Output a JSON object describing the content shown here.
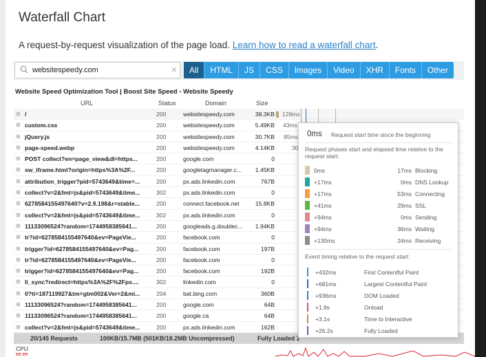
{
  "header": {
    "title": "Waterfall Chart",
    "subtitle": "A request-by-request visualization of the page load.",
    "link_text": "Learn how to read a waterfall chart",
    "link_suffix": "."
  },
  "search": {
    "value": "websitespeedy.com",
    "clear": "×"
  },
  "filters": [
    "All",
    "HTML",
    "JS",
    "CSS",
    "Images",
    "Video",
    "XHR",
    "Fonts",
    "Other"
  ],
  "table": {
    "page_title": "Website Speed Optimization Tool | Boost Site Speed - Website Speedy",
    "columns": {
      "url": "URL",
      "status": "Status",
      "domain": "Domain",
      "size": "Size"
    },
    "first_bar_label": "129ms",
    "rows": [
      {
        "url": "/",
        "status": "200",
        "domain": "websitespeedy.com",
        "size": "38.3KB",
        "bar": "129ms"
      },
      {
        "url": "custom.css",
        "status": "200",
        "domain": "websitespeedy.com",
        "size": "5.49KB",
        "bar": "43ms"
      },
      {
        "url": "jQuery.js",
        "status": "200",
        "domain": "websitespeedy.com",
        "size": "30.7KB",
        "bar": "85ms"
      },
      {
        "url": "page-speed.webp",
        "status": "200",
        "domain": "websitespeedy.com",
        "size": "4.14KB",
        "bar": "30"
      },
      {
        "url": "POST collect?en=page_view&dl=https...",
        "status": "200",
        "domain": "google.com",
        "size": "0",
        "bar": ""
      },
      {
        "url": "sw_iframe.html?origin=https%3A%2F...",
        "status": "200",
        "domain": "googletagmanager.c...",
        "size": "1.45KB",
        "bar": ""
      },
      {
        "url": "attribution_trigger?pid=5743649&time=...",
        "status": "200",
        "domain": "px.ads.linkedin.com",
        "size": "767B",
        "bar": ""
      },
      {
        "url": "collect?v=2&fmt=js&pid=5743649&time...",
        "status": "302",
        "domain": "px.ads.linkedin.com",
        "size": "0",
        "bar": ""
      },
      {
        "url": "627858415549764​0?v=2.9.198&r=stable...",
        "status": "200",
        "domain": "connect.facebook.net",
        "size": "15.8KB",
        "bar": ""
      },
      {
        "url": "collect?v=2&fmt=js&pid=5743649&time...",
        "status": "302",
        "domain": "px.ads.linkedin.com",
        "size": "0",
        "bar": ""
      },
      {
        "url": "11133096524?random=1744958385641...",
        "status": "200",
        "domain": "googleads.g.doublec...",
        "size": "1.94KB",
        "bar": ""
      },
      {
        "url": "tr?id=627858415549764​0&ev=PageVie...",
        "status": "200",
        "domain": "facebook.com",
        "size": "0",
        "bar": ""
      },
      {
        "url": "trigger?id=627858415549764​0&ev=Pag...",
        "status": "200",
        "domain": "facebook.com",
        "size": "197B",
        "bar": ""
      },
      {
        "url": "tr?id=627858415549764​0&ev=PageVie...",
        "status": "200",
        "domain": "facebook.com",
        "size": "0",
        "bar": ""
      },
      {
        "url": "trigger?id=627858415549764​0&ev=Pag...",
        "status": "200",
        "domain": "facebook.com",
        "size": "192B",
        "bar": ""
      },
      {
        "url": "li_sync?redirect=https%3A%2F%2Fpx....",
        "status": "302",
        "domain": "linkedin.com",
        "size": "0",
        "bar": ""
      },
      {
        "url": "0?ti=187119927&tm=gtm002&Ver=2&mi...",
        "status": "204",
        "domain": "bat.bing.com",
        "size": "360B",
        "bar": ""
      },
      {
        "url": "11133096524?random=1744958385641...",
        "status": "200",
        "domain": "google.com",
        "size": "64B",
        "bar": ""
      },
      {
        "url": "11133096524?random=1744958385641...",
        "status": "200",
        "domain": "google.ca",
        "size": "64B",
        "bar": ""
      },
      {
        "url": "collect?v=2&fmt=js&pid=5743649&time...",
        "status": "200",
        "domain": "px.ads.linkedin.com",
        "size": "162B",
        "bar": ""
      }
    ],
    "expander": "⊞"
  },
  "footer": {
    "requests": "20/145 Requests",
    "transfer": "100KB/15.7MB (501KB/18.2MB Uncompressed)",
    "loaded": "Fully Loaded 2"
  },
  "cpu": {
    "label": "CPU",
    "sub": "ee.ee"
  },
  "tooltip": {
    "start": "0ms",
    "start_desc": "Request start time since the beginning",
    "phases_note": "Request phases start and elapsed time relative to the request start:",
    "phases": [
      {
        "start": "0ms",
        "duration": "17ms",
        "name": "Blocking",
        "color": "#d9c6ad"
      },
      {
        "start": "+17ms",
        "duration": "0ms",
        "name": "DNS Lookup",
        "color": "#1fa7a0"
      },
      {
        "start": "+17ms",
        "duration": "53ms",
        "name": "Connecting",
        "color": "#f2a03d"
      },
      {
        "start": "+41ms",
        "duration": "29ms",
        "name": "SSL",
        "color": "#5cb83f"
      },
      {
        "start": "+94ms",
        "duration": "0ms",
        "name": "Sending",
        "color": "#e08a8a"
      },
      {
        "start": "+94ms",
        "duration": "36ms",
        "name": "Waiting",
        "color": "#9b87c0"
      },
      {
        "start": "+130ms",
        "duration": "24ms",
        "name": "Receiving",
        "color": "#8c8c8c"
      }
    ],
    "timing_note": "Event timing relative to the request start:",
    "timings": [
      {
        "value": "+432ms",
        "name": "First Contentful Paint",
        "color": "#4a8fd6"
      },
      {
        "value": "+681ms",
        "name": "Largest Contentful Paint",
        "color": "#3b5fbf"
      },
      {
        "value": "+936ms",
        "name": "DOM Loaded",
        "color": "#2f7fd0"
      },
      {
        "value": "+1.9s",
        "name": "Onload",
        "color": "#c9508f"
      },
      {
        "value": "+3.1s",
        "name": "Time to Interactive",
        "color": "#c98a50"
      },
      {
        "value": "+26.2s",
        "name": "Fully Loaded",
        "color": "#7a4fb5"
      }
    ]
  }
}
